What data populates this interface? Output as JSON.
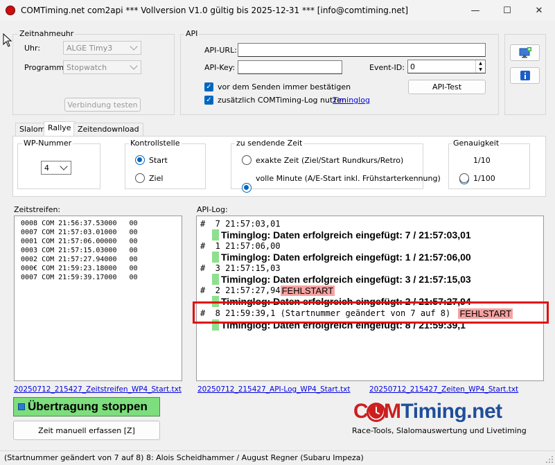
{
  "window": {
    "title": "COMTiming.net com2api *** Vollversion V1.0 gültig bis 2025-12-31 *** [info@comtiming.net]",
    "minimize_glyph": "—",
    "maximize_glyph": "☐",
    "close_glyph": "✕"
  },
  "zeitnahmeuhr": {
    "title": "Zeitnahmeuhr",
    "uhr_label": "Uhr:",
    "uhr_value": "ALGE Timy3",
    "programm_label": "Programm:",
    "programm_value": "Stopwatch",
    "test_button": "Verbindung testen"
  },
  "api": {
    "title": "API",
    "url_label": "API-URL:",
    "url_value": "",
    "key_label": "API-Key:",
    "key_value": "",
    "event_label": "Event-ID:",
    "event_value": "0",
    "confirm_label": "vor dem Senden immer bestätigen",
    "log_label": "zusätzlich COMTiming-Log nutzen",
    "log_link": "Timinglog",
    "test_button": "API-Test"
  },
  "side_icons": [
    "monitor-plus-icon",
    "info-icon"
  ],
  "tabs": [
    "Slalom",
    "Rallye",
    "Zeitendownload"
  ],
  "active_tab": "Rallye",
  "wp": {
    "title": "WP-Nummer",
    "value": "4"
  },
  "kontrollstelle": {
    "title": "Kontrollstelle",
    "options": [
      "Start",
      "Ziel"
    ],
    "selected": "Start"
  },
  "zeit": {
    "title": "zu sendende Zeit",
    "options": [
      "exakte Zeit (Ziel/Start Rundkurs/Retro)",
      "volle Minute (A/E-Start inkl. Frühstarterkennung)"
    ],
    "selected": 1
  },
  "genauigkeit": {
    "title": "Genauigkeit",
    "options": [
      "1/10",
      "1/100"
    ],
    "selected": "1/10"
  },
  "zeitstreifen": {
    "label": "Zeitstreifen:",
    "rows": [
      "0008 COM 21:56:37.53000   00",
      "0007 COM 21:57:03.01000   00",
      "0001 COM 21:57:06.00000   00",
      "0003 COM 21:57:15.03000   00",
      "0002 COM 21:57:27.94000   00",
      "000€ COM 21:59:23.18000   00",
      "0007 COM 21:59:39.17000   00"
    ],
    "file_link": "20250712_215427_Zeitstreifen_WP4_Start.txt"
  },
  "api_log": {
    "label": "API-Log:",
    "entries": [
      {
        "kind": "entry",
        "text": "#  7 21:57:03,01",
        "flag": ""
      },
      {
        "kind": "result",
        "text": "Timinglog: Daten erfolgreich eingefügt: 7 / 21:57:03,01"
      },
      {
        "kind": "entry",
        "text": "#  1 21:57:06,00",
        "flag": ""
      },
      {
        "kind": "result",
        "text": "Timinglog: Daten erfolgreich eingefügt: 1 / 21:57:06,00"
      },
      {
        "kind": "entry",
        "text": "#  3 21:57:15,03",
        "flag": ""
      },
      {
        "kind": "result",
        "text": "Timinglog: Daten erfolgreich eingefügt: 3 / 21:57:15,03"
      },
      {
        "kind": "entry",
        "text": "#  2 21:57:27,94",
        "flag": "FEHLSTART"
      },
      {
        "kind": "result",
        "text": "Timinglog: Daten erfolgreich eingefügt: 2 / 21:57:27,94"
      },
      {
        "kind": "entry",
        "text": "#  8 21:59:39,1 (Startnummer geändert von 7 auf 8) ",
        "flag": "FEHLSTART"
      },
      {
        "kind": "result",
        "text": "Timinglog: Daten erfolgreich eingefügt: 8 / 21:59:39,1"
      }
    ],
    "file_link": "20250712_215427_API-Log_WP4_Start.txt"
  },
  "zeiten_link": "20250712_215427_Zeiten_WP4_Start.txt",
  "stop_button": "Übertragung stoppen",
  "manual_button": "Zeit manuell erfassen [Z]",
  "brand": {
    "name_com": "COM",
    "name_rest": "Timing.net",
    "tagline": "Race-Tools, Slalomauswertung und Livetiming",
    "color_red": "#cc1f1f",
    "color_blue": "#1f4e9a"
  },
  "status_bar": "(Startnummer geändert von 7 auf 8) 8: Alois Scheidhammer / August Regner (Subaru Impeza)",
  "colors": {
    "highlight_border": "#e01010",
    "accent": "#0067c0",
    "stop_button_bg": "#7cde7c",
    "fehlstart_bg": "#f6a1a1"
  }
}
